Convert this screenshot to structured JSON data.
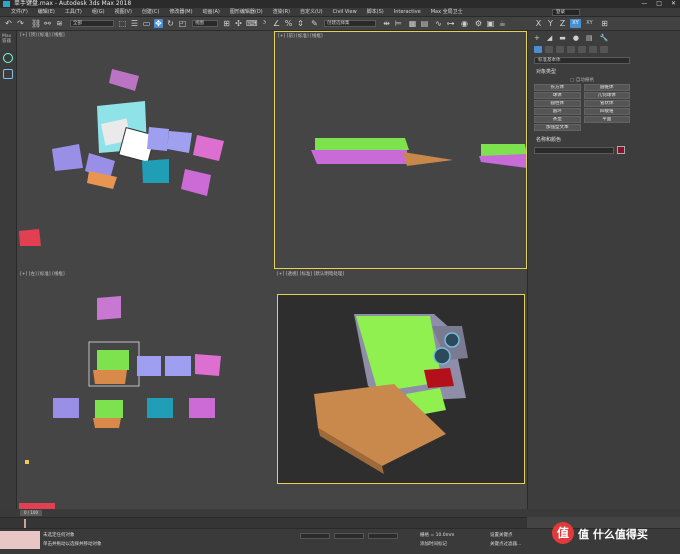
{
  "titlebar": {
    "title": "单手键盘.max - Autodesk 3ds Max 2018",
    "minimize": "—",
    "maximize": "□",
    "close": "✕"
  },
  "menubar": {
    "items": [
      "文件(F)",
      "编辑(E)",
      "工具(T)",
      "组(G)",
      "视图(V)",
      "创建(C)",
      "修改器(M)",
      "动画(A)",
      "图形编辑器(D)",
      "渲染(R)",
      "自定义(U)",
      "Civil View",
      "脚本(S)",
      "Interactive",
      "Max 全局卫士"
    ],
    "login": "登录",
    "workspace": "工作区: 默认"
  },
  "toolbar": {
    "filter_value": "全部",
    "refcoord_value": "视图",
    "selset_value": "创建选择集",
    "axis_labels": [
      "X",
      "Y",
      "Z",
      "XY",
      "XY"
    ]
  },
  "leftstrip": {
    "label": "Max 容器"
  },
  "viewports": {
    "top": "[+] [顶] [标准] [线框]",
    "front": "[+] [前] [标准] [线框]",
    "left": "[+] [左] [标准] [线框]",
    "perspective": "[+] [透视] [标准] [默认明暗处理]"
  },
  "cmd": {
    "tabs": [
      "+",
      "◢",
      "▬",
      "●",
      "▤",
      "🔧"
    ],
    "category": "标准基本体",
    "object_type_header": "对象类型",
    "autogrid": "□ 自动栅格",
    "object_buttons": [
      "长方体",
      "圆锥体",
      "球体",
      "几何球体",
      "圆柱体",
      "管状体",
      "圆环",
      "四棱锥",
      "茶壶",
      "平面",
      "加强型文本"
    ],
    "name_color_header": "名称和颜色",
    "color": "#8a1030"
  },
  "timeline": {
    "frame_text": "0 / 100"
  },
  "statusbar": {
    "line1": "未选定任何对象",
    "line2": "单击并拖动以选择并移动对象",
    "grid_text": "栅格 = 10.0mm",
    "addtime": "添加时间标记",
    "setkey": "设置关键点",
    "keyfilter": "关键点过滤器..."
  },
  "watermark": {
    "text": "值 什么值得买"
  }
}
